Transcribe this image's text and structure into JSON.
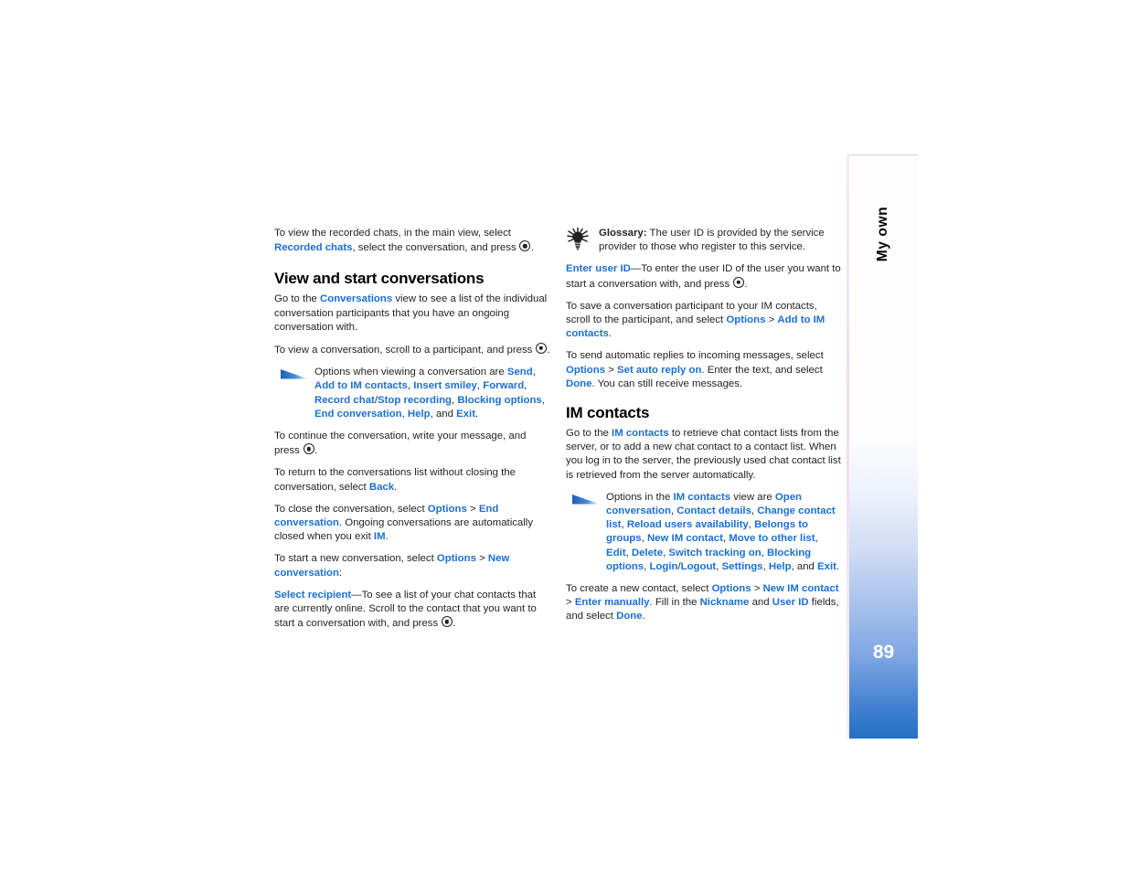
{
  "document": {
    "page_number": "89",
    "side_tab_title": "My own",
    "link_color": "#1a6fd4",
    "text_color": "#231f20"
  },
  "left_column": {
    "intro": {
      "t1": "To view the recorded chats, in the main view, select ",
      "link1": "Recorded chats",
      "t2": ", select the conversation, and press ",
      "t3": "."
    },
    "heading": "View and start conversations",
    "p_goto": {
      "t1": "Go to the ",
      "link1": "Conversations",
      "t2": " view to see a list of the individual conversation participants that you have an ongoing conversation with."
    },
    "p_view": {
      "t1": "To view a conversation, scroll to a participant, and press ",
      "t2": "."
    },
    "note_options": {
      "t1": "Options when viewing a conversation are ",
      "link1": "Send",
      "s1": ", ",
      "link2": "Add to IM contacts",
      "s2": ", ",
      "link3": "Insert smiley",
      "s3": ", ",
      "link4": "Forward",
      "s4": ", ",
      "link5": "Record chat",
      "s5": "/",
      "link6": "Stop recording",
      "s6": ", ",
      "link7": "Blocking options",
      "s7": ", ",
      "link8": "End conversation",
      "s8": ", ",
      "link9": "Help",
      "s9": ", and ",
      "link10": "Exit",
      "s10": "."
    },
    "p_continue": {
      "t1": "To continue the conversation, write your message, and press ",
      "t2": "."
    },
    "p_return": {
      "t1": "To return to the conversations list without closing the conversation, select ",
      "link1": "Back",
      "t2": "."
    },
    "p_close": {
      "t1": "To close the conversation, select ",
      "link1": "Options",
      "t2": " > ",
      "link2": "End conversation",
      "t3": ". Ongoing conversations are automatically closed when you exit ",
      "link3": "IM",
      "t4": "."
    },
    "p_start": {
      "t1": "To start a new conversation, select ",
      "link1": "Options",
      "t2": " > ",
      "link2": "New conversation",
      "t3": ":"
    },
    "p_select_recipient": {
      "link1": "Select recipient",
      "t1": "—To see a list of your chat contacts that are currently online. Scroll to the contact that you want to start a conversation with, and press ",
      "t2": "."
    }
  },
  "right_column": {
    "glossary": {
      "label": "Glossary:",
      "text": " The user ID is provided by the service provider to those who register to this service."
    },
    "p_enter_user_id": {
      "link1": "Enter user ID",
      "t1": "—To enter the user ID of the user you want to start a conversation with, and press ",
      "t2": "."
    },
    "p_save_participant": {
      "t1": "To save a conversation participant to your IM contacts, scroll to the participant, and select ",
      "link1": "Options",
      "t2": " > ",
      "link2": "Add to IM contacts",
      "t3": "."
    },
    "p_auto_reply": {
      "t1": "To send automatic replies to incoming messages, select ",
      "link1": "Options",
      "t2": " > ",
      "link2": "Set auto reply on",
      "t3": ". Enter the text, and select ",
      "link3": "Done",
      "t4": ". You can still receive messages."
    },
    "heading": "IM contacts",
    "p_goto": {
      "t1": "Go to the ",
      "link1": "IM contacts",
      "t2": " to retrieve chat contact lists from the server, or to add a new chat contact to a contact list. When you log in to the server, the previously used chat contact list is retrieved from the server automatically."
    },
    "note_options": {
      "t1": "Options in the ",
      "link0": "IM contacts",
      "t2": " view are ",
      "link1": "Open conversation",
      "s1": ", ",
      "link2": "Contact details",
      "s2": ", ",
      "link3": "Change contact list",
      "s3": ", ",
      "link4": "Reload users availability",
      "s4": ", ",
      "link5": "Belongs to groups",
      "s5": ", ",
      "link6": "New IM contact",
      "s6": ", ",
      "link7": "Move to other list",
      "s7": ", ",
      "link8": "Edit",
      "s8": ", ",
      "link9": "Delete",
      "s9": ", ",
      "link10": "Switch tracking on",
      "s10": ", ",
      "link11": "Blocking options",
      "s11": ", ",
      "link12": "Login",
      "s12": "/",
      "link13": "Logout",
      "s13": ", ",
      "link14": "Settings",
      "s14": ", ",
      "link15": "Help",
      "s15": ", and ",
      "link16": "Exit",
      "s16": "."
    },
    "p_create_contact": {
      "t1": "To create a new contact, select ",
      "link1": "Options",
      "t2": " > ",
      "link2": "New IM contact",
      "t3": " > ",
      "link3": "Enter manually",
      "t4": ". Fill in the ",
      "link4": "Nickname",
      "t5": " and ",
      "link5": "User ID",
      "t6": " fields, and select ",
      "link6": "Done",
      "t7": "."
    }
  }
}
